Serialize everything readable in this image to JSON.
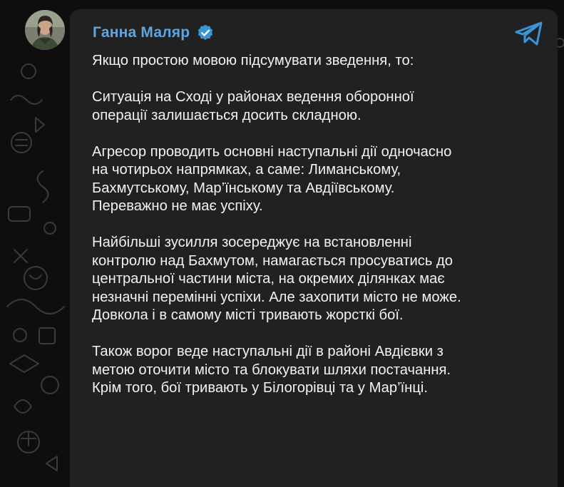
{
  "post": {
    "author": "Ганна Маляр",
    "verified_icon": "verified-badge-icon",
    "source_icon": "telegram-icon",
    "paragraphs": [
      [
        "Якщо простою мовою підсумувати зведення, то:"
      ],
      [
        "Ситуація на Сході у районах ведення оборонної",
        "операції залишається досить складною."
      ],
      [
        "Агресор проводить основні наступальні дії одночасно",
        "на чотирьох напрямках, а саме: Лиманському,",
        "Бахмутському, Мар’їнському та Авдіївському.",
        "Переважно не має успіху."
      ],
      [
        "Найбільші зусилля зосереджує на встановленні",
        "контролю над Бахмутом, намагається просуватись до",
        "центральної частини міста, на окремих ділянках має",
        "незначні перемінні успіхи. Але захопити місто не може.",
        "Довкола і в самому місті тривають жорсткі бої."
      ],
      [
        "Також ворог веде наступальні дії в районі Авдієвки з",
        "метою оточити місто та блокувати шляхи постачання.",
        "Крім того, бої тривають у Білогорівці та у Мар’їнці."
      ]
    ]
  },
  "colors": {
    "background": "#0e0e0e",
    "bubble": "#212121",
    "name": "#5ca6e3",
    "text": "#f2f2f2",
    "accent": "#3a95d8"
  }
}
